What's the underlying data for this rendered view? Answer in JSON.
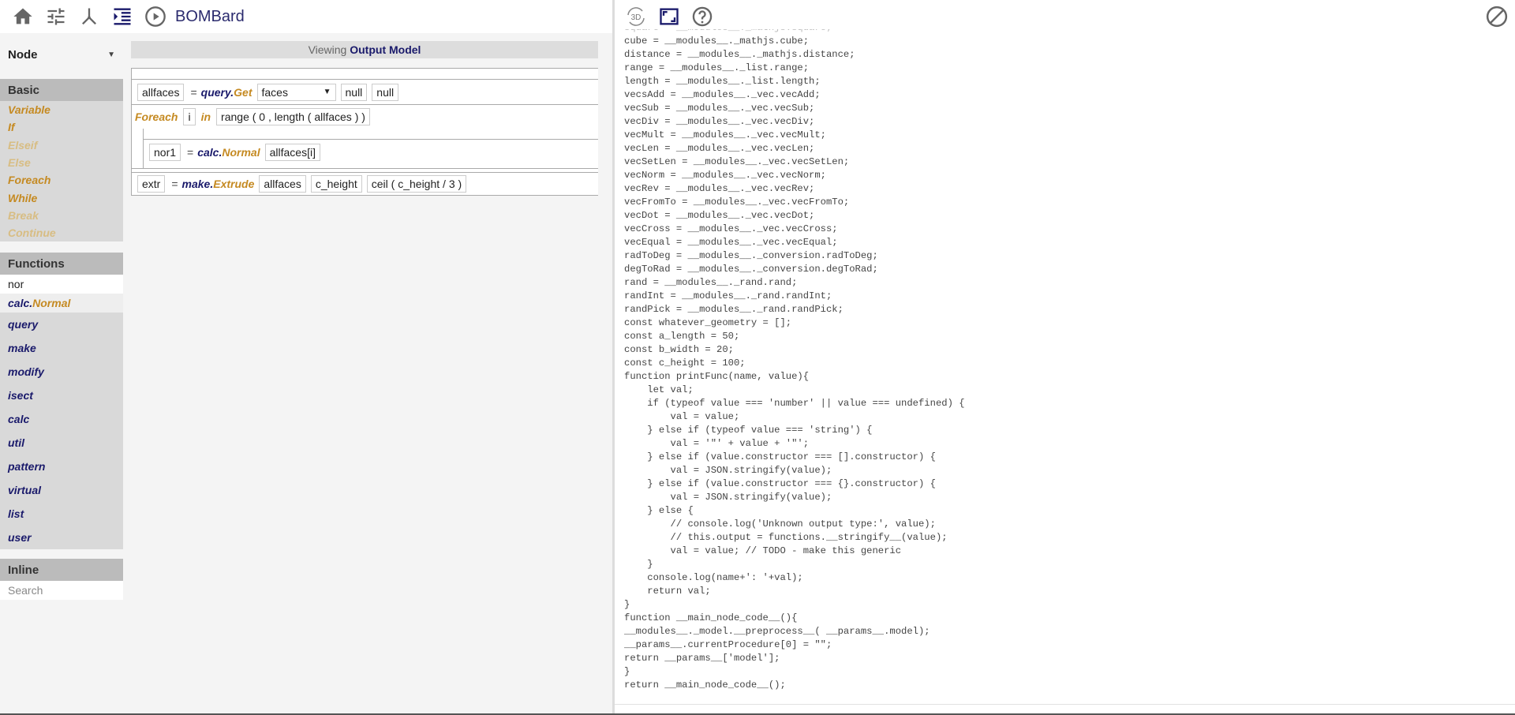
{
  "toolbar": {
    "title": "BOMBard",
    "icons": [
      "home-icon",
      "sliders-icon",
      "axis-icon",
      "indent-icon",
      "play-icon"
    ]
  },
  "sidebar": {
    "node_select": "Node",
    "basic": {
      "header": "Basic",
      "items": [
        {
          "label": "Variable",
          "enabled": true
        },
        {
          "label": "If",
          "enabled": true
        },
        {
          "label": "Elseif",
          "enabled": false
        },
        {
          "label": "Else",
          "enabled": false
        },
        {
          "label": "Foreach",
          "enabled": true
        },
        {
          "label": "While",
          "enabled": true
        },
        {
          "label": "Break",
          "enabled": false
        },
        {
          "label": "Continue",
          "enabled": false
        }
      ]
    },
    "functions": {
      "header": "Functions",
      "search_value": "nor",
      "result_module": "calc.",
      "result_function": "Normal",
      "categories": [
        "query",
        "make",
        "modify",
        "isect",
        "calc",
        "util",
        "pattern",
        "virtual",
        "list",
        "user"
      ]
    },
    "inline": {
      "header": "Inline",
      "search_placeholder": "Search"
    }
  },
  "editor": {
    "view_prefix": "Viewing ",
    "view_model": "Output Model",
    "line1": {
      "var": "allfaces",
      "eq": "=",
      "module": "query.",
      "func": "Get",
      "select": "faces",
      "arg1": "null",
      "arg2": "null"
    },
    "line2": {
      "keyword": "Foreach",
      "var": "i",
      "in": "in",
      "expr": "range ( 0 , length ( allfaces ) )"
    },
    "line3": {
      "var": "nor1",
      "eq": "=",
      "module": "calc.",
      "func": "Normal",
      "arg1": "allfaces[i]"
    },
    "line4": {
      "var": "extr",
      "eq": "=",
      "module": "make.",
      "func": "Extrude",
      "arg1": "allfaces",
      "arg2": "c_height",
      "arg3": "ceil ( c_height / 3 )"
    }
  },
  "right_toolbar": {
    "icons": [
      "3d-icon",
      "fullscreen-icon",
      "help-icon"
    ],
    "label_3d": "3D"
  },
  "code": {
    "lines": [
      "square = __modules__._mathjs.square;",
      "cube = __modules__._mathjs.cube;",
      "distance = __modules__._mathjs.distance;",
      "range = __modules__._list.range;",
      "length = __modules__._list.length;",
      "vecsAdd = __modules__._vec.vecAdd;",
      "vecSub = __modules__._vec.vecSub;",
      "vecDiv = __modules__._vec.vecDiv;",
      "vecMult = __modules__._vec.vecMult;",
      "vecLen = __modules__._vec.vecLen;",
      "vecSetLen = __modules__._vec.vecSetLen;",
      "vecNorm = __modules__._vec.vecNorm;",
      "vecRev = __modules__._vec.vecRev;",
      "vecFromTo = __modules__._vec.vecFromTo;",
      "vecDot = __modules__._vec.vecDot;",
      "vecCross = __modules__._vec.vecCross;",
      "vecEqual = __modules__._vec.vecEqual;",
      "radToDeg = __modules__._conversion.radToDeg;",
      "degToRad = __modules__._conversion.degToRad;",
      "rand = __modules__._rand.rand;",
      "randInt = __modules__._rand.randInt;",
      "randPick = __modules__._rand.randPick;",
      "const whatever_geometry = [];",
      "const a_length = 50;",
      "const b_width = 20;",
      "const c_height = 100;",
      "function printFunc(name, value){",
      "    let val;",
      "    if (typeof value === 'number' || value === undefined) {",
      "        val = value;",
      "    } else if (typeof value === 'string') {",
      "        val = '\"' + value + '\"';",
      "    } else if (value.constructor === [].constructor) {",
      "        val = JSON.stringify(value);",
      "    } else if (value.constructor === {}.constructor) {",
      "        val = JSON.stringify(value);",
      "    } else {",
      "        // console.log('Unknown output type:', value);",
      "        // this.output = functions.__stringify__(value);",
      "        val = value; // TODO - make this generic",
      "    }",
      "    console.log(name+': '+val);",
      "    return val;",
      "}",
      "function __main_node_code__(){",
      "__modules__._model.__preprocess__( __params__.model);",
      "__params__.currentProcedure[0] = \"\";",
      "return __params__['model'];",
      "}",
      "return __main_node_code__();"
    ]
  }
}
